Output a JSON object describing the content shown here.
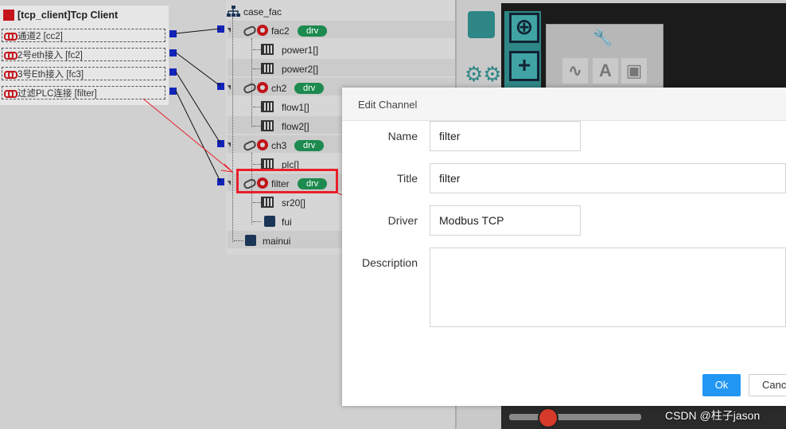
{
  "client_panel": {
    "title": "[tcp_client]Tcp Client",
    "connections": [
      {
        "label": "通道2 [cc2]"
      },
      {
        "label": "2号eth接入 [fc2]"
      },
      {
        "label": "3号Eth接入 [fc3]"
      },
      {
        "label": "过滤PLC连接 [filter]"
      }
    ]
  },
  "tree": {
    "root": "case_fac",
    "channels": [
      {
        "name": "fac2",
        "badge": "drv",
        "children": [
          "power1[]",
          "power2[]"
        ]
      },
      {
        "name": "ch2",
        "badge": "drv",
        "children": [
          "flow1[]",
          "flow2[]"
        ]
      },
      {
        "name": "ch3",
        "badge": "drv",
        "children": [
          "plc[]"
        ]
      },
      {
        "name": "filter",
        "badge": "drv",
        "children": [
          "sr20[]",
          "fui"
        ]
      }
    ],
    "last": "mainui"
  },
  "dialog": {
    "title": "Edit Channel",
    "name_label": "Name",
    "name_value": "filter",
    "title_label": "Title",
    "title_value": "filter",
    "driver_label": "Driver",
    "driver_value": "Modbus TCP",
    "description_label": "Description",
    "description_value": "",
    "ok_label": "Ok",
    "cancel_label": "Cance"
  },
  "watermark": "CSDN @柱子jason",
  "colors": {
    "accent": "#2196f3",
    "badge": "#1d8a4f",
    "highlight": "#e8202a",
    "teal": "#2f8686"
  }
}
